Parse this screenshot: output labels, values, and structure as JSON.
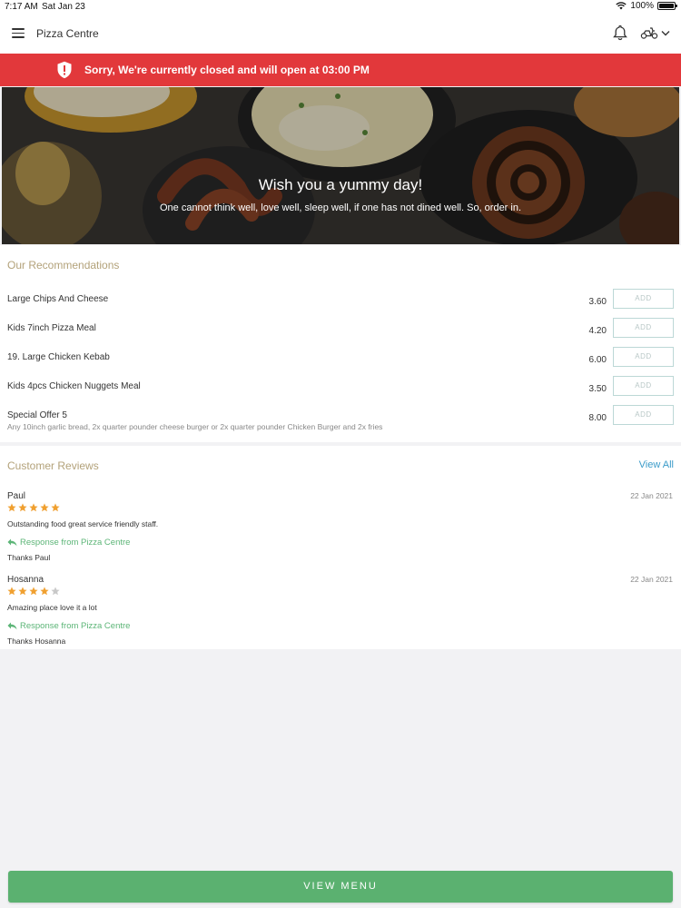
{
  "status_bar": {
    "time": "7:17 AM",
    "date": "Sat Jan 23",
    "battery": "100%"
  },
  "header": {
    "title": "Pizza Centre"
  },
  "banner": {
    "message": "Sorry, We're currently closed and will open at 03:00 PM",
    "color": "#e2383b"
  },
  "hero": {
    "headline": "Wish you a yummy day!",
    "subtext": "One cannot think well, love well, sleep well, if one has not dined well. So, order in."
  },
  "recommendations": {
    "title": "Our Recommendations",
    "add_label": "ADD",
    "items": [
      {
        "name": "Large Chips And Cheese",
        "price": "3.60",
        "description": ""
      },
      {
        "name": "Kids 7inch Pizza Meal",
        "price": "4.20",
        "description": ""
      },
      {
        "name": "19. Large Chicken Kebab",
        "price": "6.00",
        "description": ""
      },
      {
        "name": "Kids 4pcs Chicken Nuggets Meal",
        "price": "3.50",
        "description": ""
      },
      {
        "name": "Special Offer 5",
        "price": "8.00",
        "description": "Any 10inch garlic bread, 2x quarter pounder cheese burger or 2x quarter pounder Chicken Burger and 2x fries"
      }
    ]
  },
  "reviews": {
    "title": "Customer Reviews",
    "view_all": "View All",
    "response_label": "Response from Pizza Centre",
    "items": [
      {
        "author": "Paul",
        "date": "22 Jan 2021",
        "rating": 5,
        "text": "Outstanding food great service friendly staff.",
        "reply": "Thanks Paul"
      },
      {
        "author": "Hosanna",
        "date": "22 Jan 2021",
        "rating": 4,
        "text": "Amazing place love it a lot",
        "reply": "Thanks Hosanna"
      }
    ]
  },
  "footer": {
    "view_menu": "VIEW MENU",
    "color": "#5bb170"
  }
}
